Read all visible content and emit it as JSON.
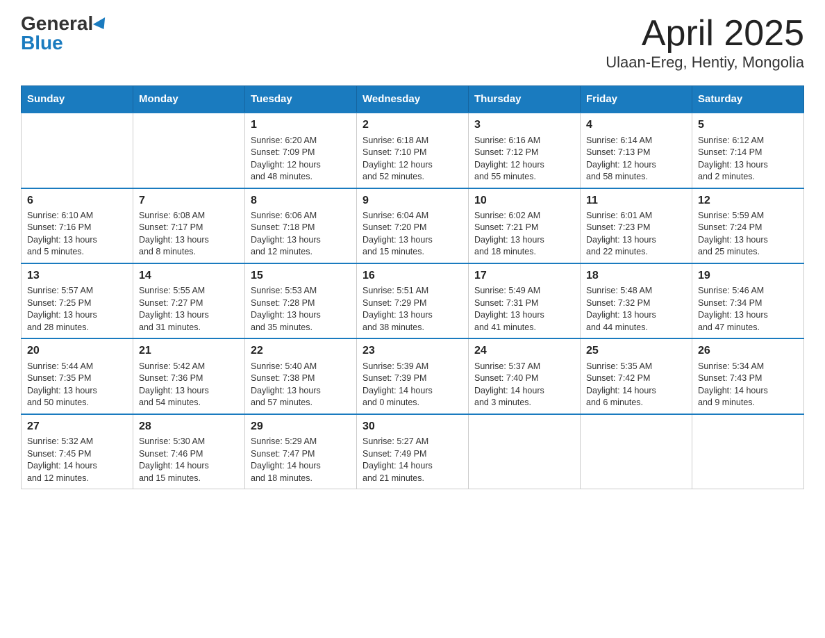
{
  "header": {
    "logo_line1": "General",
    "logo_line2": "Blue",
    "month_title": "April 2025",
    "location": "Ulaan-Ereg, Hentiy, Mongolia"
  },
  "days_of_week": [
    "Sunday",
    "Monday",
    "Tuesday",
    "Wednesday",
    "Thursday",
    "Friday",
    "Saturday"
  ],
  "weeks": [
    [
      {
        "day": "",
        "info": ""
      },
      {
        "day": "",
        "info": ""
      },
      {
        "day": "1",
        "info": "Sunrise: 6:20 AM\nSunset: 7:09 PM\nDaylight: 12 hours\nand 48 minutes."
      },
      {
        "day": "2",
        "info": "Sunrise: 6:18 AM\nSunset: 7:10 PM\nDaylight: 12 hours\nand 52 minutes."
      },
      {
        "day": "3",
        "info": "Sunrise: 6:16 AM\nSunset: 7:12 PM\nDaylight: 12 hours\nand 55 minutes."
      },
      {
        "day": "4",
        "info": "Sunrise: 6:14 AM\nSunset: 7:13 PM\nDaylight: 12 hours\nand 58 minutes."
      },
      {
        "day": "5",
        "info": "Sunrise: 6:12 AM\nSunset: 7:14 PM\nDaylight: 13 hours\nand 2 minutes."
      }
    ],
    [
      {
        "day": "6",
        "info": "Sunrise: 6:10 AM\nSunset: 7:16 PM\nDaylight: 13 hours\nand 5 minutes."
      },
      {
        "day": "7",
        "info": "Sunrise: 6:08 AM\nSunset: 7:17 PM\nDaylight: 13 hours\nand 8 minutes."
      },
      {
        "day": "8",
        "info": "Sunrise: 6:06 AM\nSunset: 7:18 PM\nDaylight: 13 hours\nand 12 minutes."
      },
      {
        "day": "9",
        "info": "Sunrise: 6:04 AM\nSunset: 7:20 PM\nDaylight: 13 hours\nand 15 minutes."
      },
      {
        "day": "10",
        "info": "Sunrise: 6:02 AM\nSunset: 7:21 PM\nDaylight: 13 hours\nand 18 minutes."
      },
      {
        "day": "11",
        "info": "Sunrise: 6:01 AM\nSunset: 7:23 PM\nDaylight: 13 hours\nand 22 minutes."
      },
      {
        "day": "12",
        "info": "Sunrise: 5:59 AM\nSunset: 7:24 PM\nDaylight: 13 hours\nand 25 minutes."
      }
    ],
    [
      {
        "day": "13",
        "info": "Sunrise: 5:57 AM\nSunset: 7:25 PM\nDaylight: 13 hours\nand 28 minutes."
      },
      {
        "day": "14",
        "info": "Sunrise: 5:55 AM\nSunset: 7:27 PM\nDaylight: 13 hours\nand 31 minutes."
      },
      {
        "day": "15",
        "info": "Sunrise: 5:53 AM\nSunset: 7:28 PM\nDaylight: 13 hours\nand 35 minutes."
      },
      {
        "day": "16",
        "info": "Sunrise: 5:51 AM\nSunset: 7:29 PM\nDaylight: 13 hours\nand 38 minutes."
      },
      {
        "day": "17",
        "info": "Sunrise: 5:49 AM\nSunset: 7:31 PM\nDaylight: 13 hours\nand 41 minutes."
      },
      {
        "day": "18",
        "info": "Sunrise: 5:48 AM\nSunset: 7:32 PM\nDaylight: 13 hours\nand 44 minutes."
      },
      {
        "day": "19",
        "info": "Sunrise: 5:46 AM\nSunset: 7:34 PM\nDaylight: 13 hours\nand 47 minutes."
      }
    ],
    [
      {
        "day": "20",
        "info": "Sunrise: 5:44 AM\nSunset: 7:35 PM\nDaylight: 13 hours\nand 50 minutes."
      },
      {
        "day": "21",
        "info": "Sunrise: 5:42 AM\nSunset: 7:36 PM\nDaylight: 13 hours\nand 54 minutes."
      },
      {
        "day": "22",
        "info": "Sunrise: 5:40 AM\nSunset: 7:38 PM\nDaylight: 13 hours\nand 57 minutes."
      },
      {
        "day": "23",
        "info": "Sunrise: 5:39 AM\nSunset: 7:39 PM\nDaylight: 14 hours\nand 0 minutes."
      },
      {
        "day": "24",
        "info": "Sunrise: 5:37 AM\nSunset: 7:40 PM\nDaylight: 14 hours\nand 3 minutes."
      },
      {
        "day": "25",
        "info": "Sunrise: 5:35 AM\nSunset: 7:42 PM\nDaylight: 14 hours\nand 6 minutes."
      },
      {
        "day": "26",
        "info": "Sunrise: 5:34 AM\nSunset: 7:43 PM\nDaylight: 14 hours\nand 9 minutes."
      }
    ],
    [
      {
        "day": "27",
        "info": "Sunrise: 5:32 AM\nSunset: 7:45 PM\nDaylight: 14 hours\nand 12 minutes."
      },
      {
        "day": "28",
        "info": "Sunrise: 5:30 AM\nSunset: 7:46 PM\nDaylight: 14 hours\nand 15 minutes."
      },
      {
        "day": "29",
        "info": "Sunrise: 5:29 AM\nSunset: 7:47 PM\nDaylight: 14 hours\nand 18 minutes."
      },
      {
        "day": "30",
        "info": "Sunrise: 5:27 AM\nSunset: 7:49 PM\nDaylight: 14 hours\nand 21 minutes."
      },
      {
        "day": "",
        "info": ""
      },
      {
        "day": "",
        "info": ""
      },
      {
        "day": "",
        "info": ""
      }
    ]
  ]
}
